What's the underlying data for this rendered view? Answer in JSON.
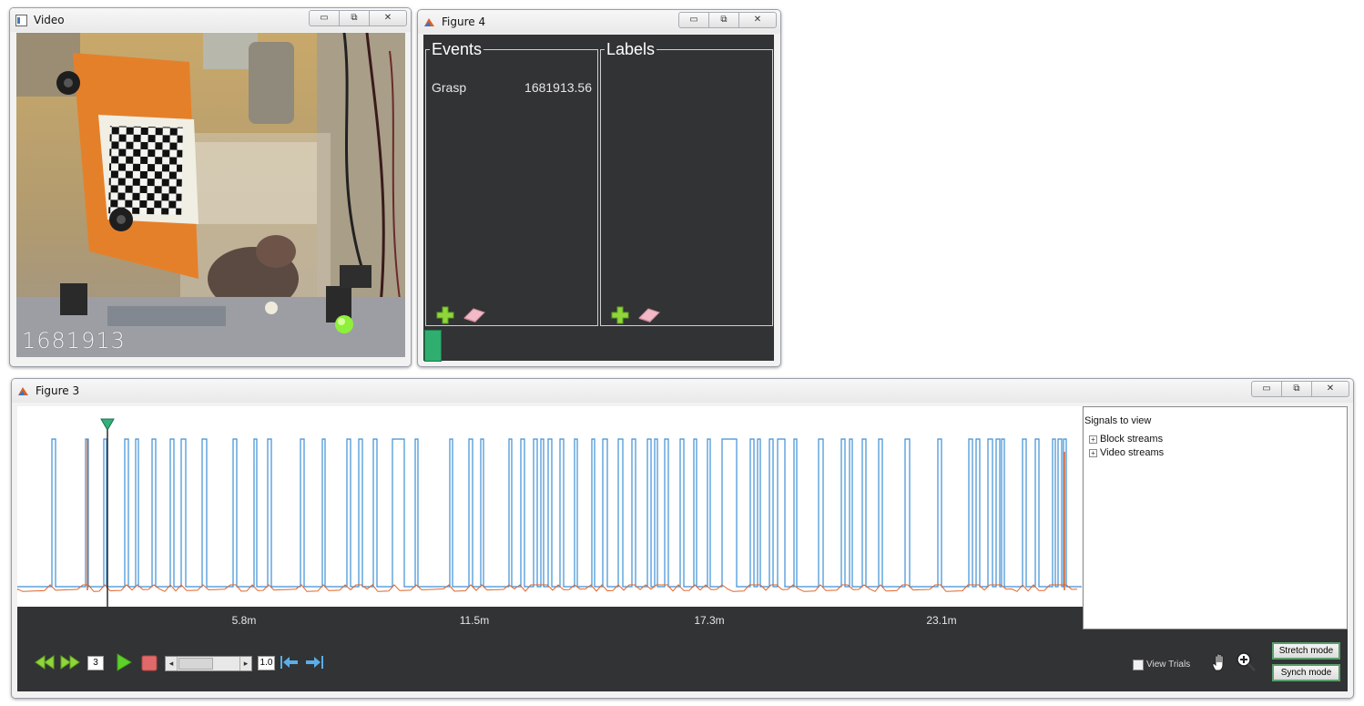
{
  "video_window": {
    "title": "Video",
    "frame_counter": "1681913"
  },
  "figure4": {
    "title": "Figure 4",
    "events_panel": {
      "title": "Events",
      "rows": [
        {
          "name": "Grasp",
          "time": "1681913.56"
        }
      ]
    },
    "labels_panel": {
      "title": "Labels"
    }
  },
  "figure3": {
    "title": "Figure 3",
    "time_axis_ticks": [
      "5.8m",
      "11.5m",
      "17.3m",
      "23.1m"
    ],
    "signals_panel": {
      "title": "Signals to view",
      "tree_items": [
        "Block streams",
        "Video streams"
      ]
    },
    "controls": {
      "speed_value": "3",
      "zoom_value": "1.0",
      "view_trials_label": "View Trials",
      "view_trials_checked": false,
      "stretch_mode_label": "Stretch mode",
      "synch_mode_label": "Synch mode"
    },
    "colors": {
      "blue_trace": "#3d8fd6",
      "orange_trace": "#e0642a",
      "marker": "#33b07a",
      "dark_bg": "#323335"
    }
  },
  "window_buttons": {
    "minimize": "▭",
    "restore": "⧉",
    "close": "✕"
  }
}
